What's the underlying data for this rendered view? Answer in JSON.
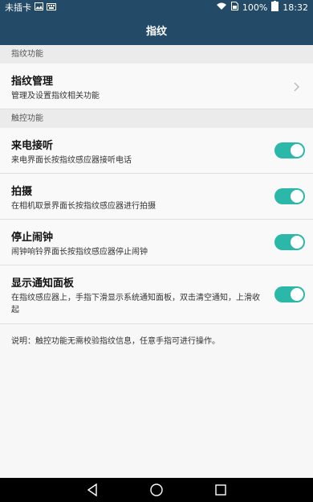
{
  "status": {
    "carrier": "未插卡",
    "battery": "100%",
    "time": "18:32"
  },
  "header": {
    "title": "指纹"
  },
  "sections": {
    "fingerprint": "指纹功能",
    "touch": "触控功能"
  },
  "manage": {
    "title": "指纹管理",
    "subtitle": "管理及设置指纹相关功能"
  },
  "touch_items": [
    {
      "title": "来电接听",
      "subtitle": "来电界面长按指纹感应器接听电话",
      "enabled": true
    },
    {
      "title": "拍摄",
      "subtitle": "在相机取景界面长按指纹感应器进行拍摄",
      "enabled": true
    },
    {
      "title": "停止闹钟",
      "subtitle": "闹钟响铃界面长按指纹感应器停止闹钟",
      "enabled": true
    },
    {
      "title": "显示通知面板",
      "subtitle": "在指纹感应器上，手指下滑显示系统通知面板，双击清空通知，上滑收起",
      "enabled": true
    }
  ],
  "note": "说明：触控功能无需校验指纹信息，任意手指可进行操作。",
  "colors": {
    "appbar": "#234a66",
    "toggle_on": "#2bb8a8"
  },
  "icons": {
    "back": "back-triangle-icon",
    "home": "home-circle-icon",
    "recents": "recents-square-icon"
  }
}
